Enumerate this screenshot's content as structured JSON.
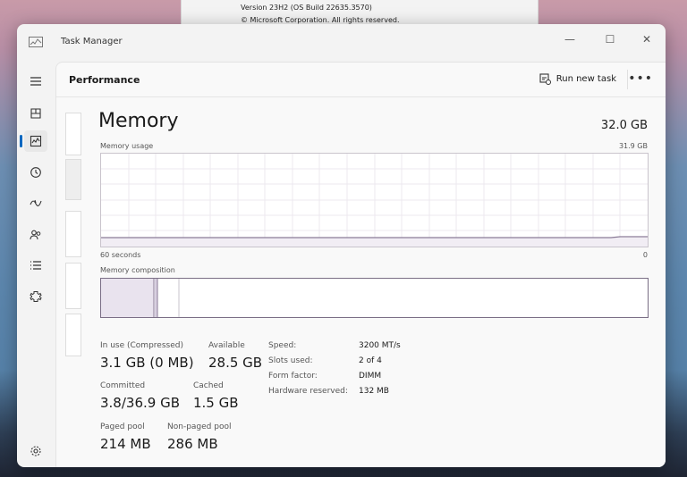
{
  "about": {
    "version_line": "Version 23H2 (OS Build 22635.3570)",
    "copyright_line": "© Microsoft Corporation. All rights reserved."
  },
  "window": {
    "title": "Task Manager",
    "minimize": "—",
    "maximize": "☐",
    "close": "✕"
  },
  "sidebar": {
    "items": [
      {
        "name": "menu",
        "icon": "hamburger-icon"
      },
      {
        "name": "processes",
        "icon": "processes-icon"
      },
      {
        "name": "performance",
        "icon": "performance-icon",
        "active": true
      },
      {
        "name": "app-history",
        "icon": "history-icon"
      },
      {
        "name": "startup-apps",
        "icon": "startup-icon"
      },
      {
        "name": "users",
        "icon": "users-icon"
      },
      {
        "name": "details",
        "icon": "details-icon"
      },
      {
        "name": "services",
        "icon": "services-icon"
      },
      {
        "name": "settings",
        "icon": "gear-icon"
      }
    ]
  },
  "header": {
    "title": "Performance",
    "run_new_task": "Run new task",
    "more": "•••"
  },
  "memory": {
    "title": "Memory",
    "total": "32.0 GB",
    "usage_label": "Memory usage",
    "usage_max": "31.9 GB",
    "time_left": "60 seconds",
    "time_right": "0",
    "composition_label": "Memory composition",
    "composition": {
      "in_use_fraction": 0.097,
      "modified_fraction": 0.004,
      "standby_fraction": 0.039
    },
    "in_use_label": "In use (Compressed)",
    "in_use_value": "3.1 GB (0 MB)",
    "available_label": "Available",
    "available_value": "28.5 GB",
    "committed_label": "Committed",
    "committed_value": "3.8/36.9 GB",
    "cached_label": "Cached",
    "cached_value": "1.5 GB",
    "paged_label": "Paged pool",
    "paged_value": "214 MB",
    "nonpaged_label": "Non-paged pool",
    "nonpaged_value": "286 MB",
    "specs": [
      {
        "label": "Speed:",
        "value": "3200 MT/s"
      },
      {
        "label": "Slots used:",
        "value": "2 of 4"
      },
      {
        "label": "Form factor:",
        "value": "DIMM"
      },
      {
        "label": "Hardware reserved:",
        "value": "132 MB"
      }
    ]
  },
  "colors": {
    "accent": "#0067c0",
    "memory_line": "#8a7b97",
    "memory_fill": "#e9e3ee"
  }
}
